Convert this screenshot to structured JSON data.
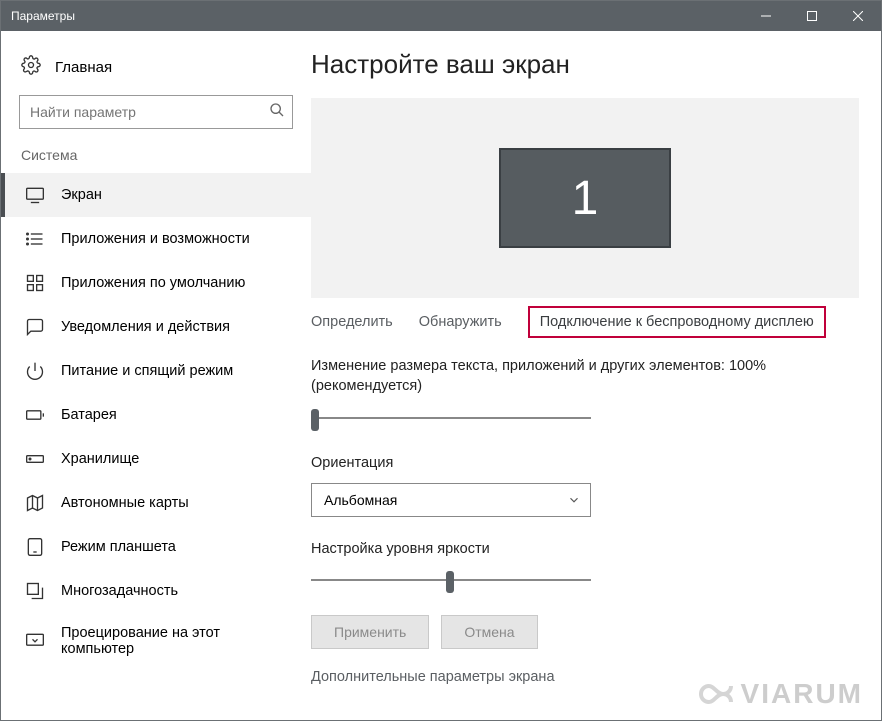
{
  "window": {
    "title": "Параметры"
  },
  "sidebar": {
    "home_label": "Главная",
    "search_placeholder": "Найти параметр",
    "section_label": "Система",
    "items": [
      {
        "label": "Экран"
      },
      {
        "label": "Приложения и возможности"
      },
      {
        "label": "Приложения по умолчанию"
      },
      {
        "label": "Уведомления и действия"
      },
      {
        "label": "Питание и спящий режим"
      },
      {
        "label": "Батарея"
      },
      {
        "label": "Хранилище"
      },
      {
        "label": "Автономные карты"
      },
      {
        "label": "Режим планшета"
      },
      {
        "label": "Многозадачность"
      },
      {
        "label": "Проецирование на этот компьютер"
      }
    ]
  },
  "main": {
    "title": "Настройте ваш экран",
    "monitor_number": "1",
    "links": {
      "identify": "Определить",
      "detect": "Обнаружить",
      "wireless": "Подключение к беспроводному дисплею"
    },
    "scaling_label": "Изменение размера текста, приложений и других элементов: 100% (рекомендуется)",
    "orientation_label": "Ориентация",
    "orientation_value": "Альбомная",
    "brightness_label": "Настройка уровня яркости",
    "apply_label": "Применить",
    "cancel_label": "Отмена",
    "advanced_link": "Дополнительные параметры экрана"
  },
  "watermark": {
    "text": "VIARUM"
  }
}
